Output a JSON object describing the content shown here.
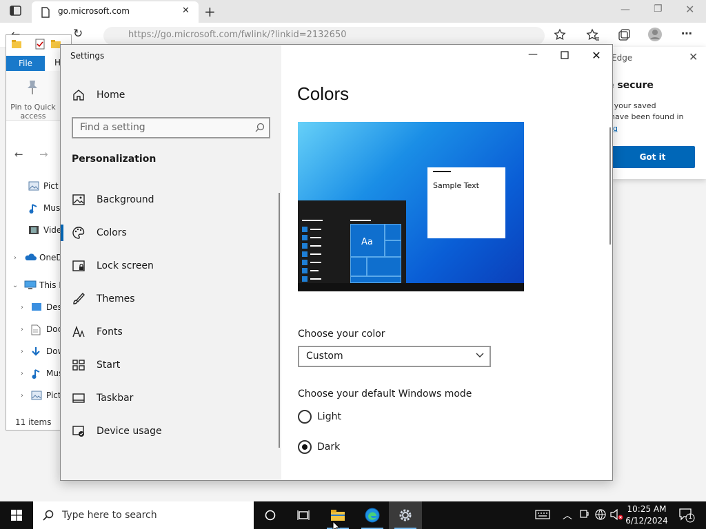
{
  "edge": {
    "tab_title": "go.microsoft.com",
    "address": "https://go.microsoft.com/fwlink/?linkid=2132650",
    "popup": {
      "brand": "Edge",
      "heading": "e secure",
      "body_line1": "ks your saved",
      "body_line2": "y have been found in",
      "link": "ing",
      "button": "Got it"
    }
  },
  "explorer": {
    "file_tab": "File",
    "home_tab": "H",
    "pin_label": "Pin to Quick access",
    "items": [
      "Pict",
      "Mus",
      "Vide",
      "OneD",
      "This P",
      "Desk",
      "Doc",
      "Dow",
      "Mus",
      "Pict"
    ],
    "status": "11 items"
  },
  "settings": {
    "window_title": "Settings",
    "home": "Home",
    "search_placeholder": "Find a setting",
    "section": "Personalization",
    "nav": [
      "Background",
      "Colors",
      "Lock screen",
      "Themes",
      "Fonts",
      "Start",
      "Taskbar",
      "Device usage"
    ],
    "active_nav": "Colors",
    "page_title": "Colors",
    "preview_sample_text": "Sample Text",
    "preview_tile_text": "Aa",
    "choose_color_label": "Choose your color",
    "choose_color_value": "Custom",
    "mode_label": "Choose your default Windows mode",
    "mode_options": [
      "Light",
      "Dark"
    ],
    "mode_selected": "Dark"
  },
  "taskbar": {
    "search_placeholder": "Type here to search",
    "time": "10:25 AM",
    "date": "6/12/2024",
    "notification_count": "1"
  },
  "colors": {
    "accent": "#0063b1",
    "taskbar": "#101010",
    "edge_button": "#0067b8"
  }
}
